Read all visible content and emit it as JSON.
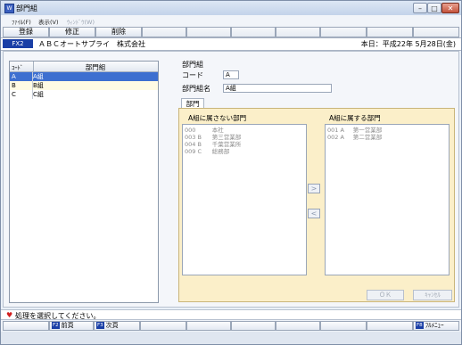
{
  "window": {
    "title": "部門組",
    "icon_label": "W",
    "controls": {
      "minimize": "–",
      "maximize": "□",
      "close": "✕"
    }
  },
  "menu": [
    {
      "label": "ﾌｧｲﾙ(F)",
      "enabled": true
    },
    {
      "label": "表示(V)",
      "enabled": true
    },
    {
      "label": "ｳｨﾝﾄﾞｳ(W)",
      "enabled": false
    }
  ],
  "toolbar": {
    "register": "登録",
    "modify": "修正",
    "delete": "削除"
  },
  "header": {
    "fx_badge": "FX2",
    "company": "ＡＢＣオートサプライ　株式会社",
    "date": "本日：平成22年 5月28日(金)"
  },
  "list": {
    "columns": {
      "code": "ｺｰﾄﾞ",
      "name": "部門組"
    },
    "rows": [
      {
        "code": "A",
        "name": "A組"
      },
      {
        "code": "B",
        "name": "B組"
      },
      {
        "code": "C",
        "name": "C組"
      }
    ]
  },
  "detail": {
    "section_label": "部門組",
    "code_label": "コード",
    "code_value": "A",
    "name_label": "部門組名",
    "name_value": "A組"
  },
  "tab": {
    "label": "部門"
  },
  "transfer": {
    "left_title": "A組に属さない部門",
    "right_title": "A組に属する部門",
    "left_items": [
      {
        "code": "000",
        "group": "",
        "name": "本社"
      },
      {
        "code": "003",
        "group": "B",
        "name": "第三営業部"
      },
      {
        "code": "004",
        "group": "B",
        "name": "千葉営業所"
      },
      {
        "code": "009",
        "group": "C",
        "name": "総務部"
      }
    ],
    "right_items": [
      {
        "code": "001",
        "group": "A",
        "name": "第一営業部"
      },
      {
        "code": "002",
        "group": "A",
        "name": "第二営業部"
      }
    ],
    "add_button": ">",
    "remove_button": "<"
  },
  "actions": {
    "ok": "ＯＫ",
    "cancel": "ｷｬﾝｾﾙ"
  },
  "status": {
    "message": "処理を選択してください。"
  },
  "function_keys": {
    "prev": {
      "key": "F2",
      "label": "前頁"
    },
    "next": {
      "key": "F3",
      "label": "次頁"
    },
    "menu": {
      "key": "F8",
      "label": "ﾌﾙﾒﾆｭｰ"
    }
  },
  "colors": {
    "selection": "#3d6fd0",
    "badge": "#1a3fa6",
    "panel": "#fbefc9",
    "heart": "#d21f1f"
  }
}
